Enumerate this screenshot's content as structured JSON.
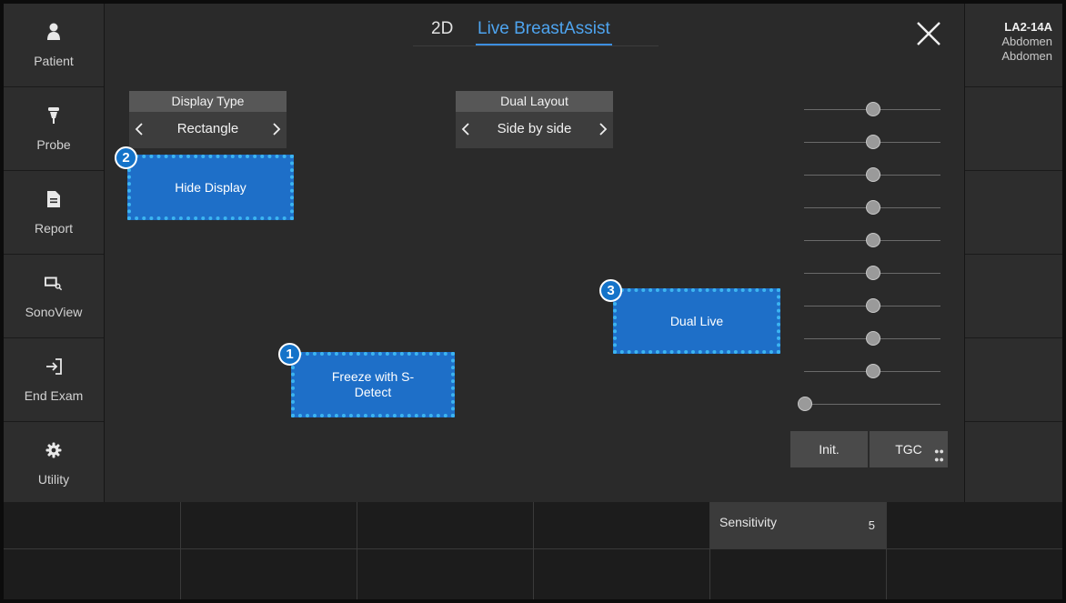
{
  "sidebar": {
    "items": [
      {
        "label": "Patient",
        "icon": "person-icon"
      },
      {
        "label": "Probe",
        "icon": "probe-icon"
      },
      {
        "label": "Report",
        "icon": "document-icon"
      },
      {
        "label": "SonoView",
        "icon": "sonoview-icon"
      },
      {
        "label": "End Exam",
        "icon": "exit-icon"
      },
      {
        "label": "Utility",
        "icon": "gear-icon"
      }
    ]
  },
  "header": {
    "tabs": [
      {
        "label": "2D",
        "active": false
      },
      {
        "label": "Live BreastAssist",
        "active": true
      }
    ],
    "close_icon": "close-icon"
  },
  "probe_info": {
    "name": "LA2-14A",
    "line1": "Abdomen",
    "line2": "Abdomen"
  },
  "display_type": {
    "title": "Display Type",
    "value": "Rectangle"
  },
  "dual_layout": {
    "title": "Dual Layout",
    "value": "Side by side"
  },
  "buttons": {
    "freeze": {
      "label": "Freeze with S-Detect",
      "badge": "1"
    },
    "hide_display": {
      "label": "Hide Display",
      "badge": "2"
    },
    "dual_live": {
      "label": "Dual Live",
      "badge": "3"
    }
  },
  "tgc": {
    "slider_levels": [
      0.5,
      0.5,
      0.5,
      0.5,
      0.5,
      0.5,
      0.5,
      0.5,
      0.5,
      0.0
    ],
    "init_label": "Init.",
    "tgc_label": "TGC"
  },
  "bottom": {
    "sensitivity_label": "Sensitivity",
    "sensitivity_value": "5"
  },
  "colors": {
    "accent": "#3d8fe0",
    "button_blue": "#1e6fc8",
    "highlight_dotted": "#3cb4f0"
  }
}
